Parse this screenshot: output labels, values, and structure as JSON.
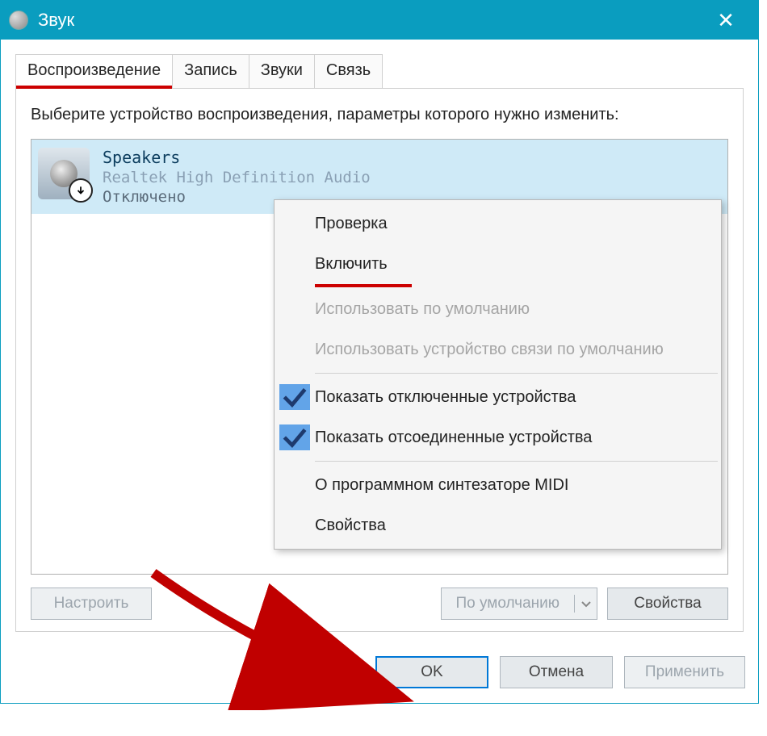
{
  "window": {
    "title": "Звук"
  },
  "tabs": {
    "items": [
      {
        "label": "Воспроизведение",
        "active": true
      },
      {
        "label": "Запись",
        "active": false
      },
      {
        "label": "Звуки",
        "active": false
      },
      {
        "label": "Связь",
        "active": false
      }
    ]
  },
  "instruction_text": "Выберите устройство воспроизведения, параметры которого нужно изменить:",
  "device": {
    "name": "Speakers",
    "driver": "Realtek High Definition Audio",
    "status": "Отключено"
  },
  "context_menu": {
    "items": [
      {
        "label": "Проверка",
        "enabled": true,
        "checked": false
      },
      {
        "label": "Включить",
        "enabled": true,
        "checked": false,
        "highlighted": true
      },
      {
        "label": "Использовать по умолчанию",
        "enabled": false,
        "checked": false
      },
      {
        "label": "Использовать устройство связи по умолчанию",
        "enabled": false,
        "checked": false,
        "separator_after": true
      },
      {
        "label": "Показать отключенные устройства",
        "enabled": true,
        "checked": true
      },
      {
        "label": "Показать отсоединенные устройства",
        "enabled": true,
        "checked": true,
        "separator_after": true
      },
      {
        "label": "О программном синтезаторе MIDI",
        "enabled": true,
        "checked": false
      },
      {
        "label": "Свойства",
        "enabled": true,
        "checked": false
      }
    ]
  },
  "panel_buttons": {
    "configure": "Настроить",
    "set_default": "По умолчанию",
    "properties": "Свойства"
  },
  "dialog_buttons": {
    "ok": "OK",
    "cancel": "Отмена",
    "apply": "Применить"
  }
}
